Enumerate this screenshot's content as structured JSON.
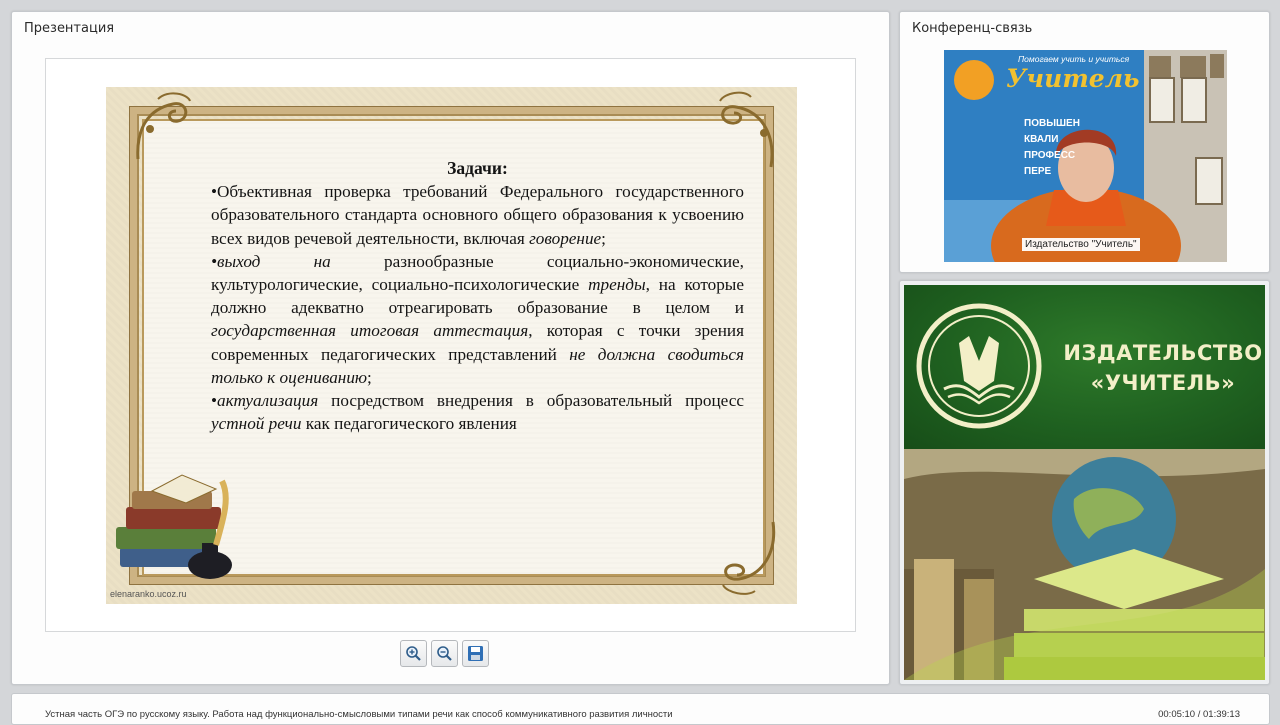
{
  "presentation": {
    "title": "Презентация",
    "slide": {
      "heading": "Задачи:",
      "credit": "elenaranko.ucoz.ru",
      "p1_a": "•Объективная проверка требований Федерального государственного образовательного стандарта основного общего образования к усвоению всех видов речевой деятельности, включая ",
      "p1_it": "говорение",
      "p1_end": ";",
      "p2_it1": "•выход на",
      "p2_b": " разнообразные социально-экономические, культурологические, социально-психологические ",
      "p2_it2": "тренды",
      "p2_c": ", на которые должно адекватно отреагировать образование в целом и ",
      "p2_it3": "государственная итоговая аттестация",
      "p2_d": ", которая с точки зрения современных педагогических представлений ",
      "p2_it4": "не должна сводиться только к оцениванию",
      "p2_end": ";",
      "p3_bullet": "•",
      "p3_it1": "актуализация",
      "p3_b": " посредством внедрения в образовательный процесс ",
      "p3_it2": "устной речи",
      "p3_c": " как педагогического явления"
    },
    "toolbar": {
      "zoom_in_icon": "zoom-in-icon",
      "zoom_out_icon": "zoom-out-icon",
      "save_icon": "save-icon"
    }
  },
  "conference": {
    "title": "Конференц-связь",
    "participant_label": "Издательство \"Учитель\"",
    "banner_small": "Помогаем учить и учиться",
    "banner_big": "Учитель",
    "banner_line1": "ПОВЫШЕН",
    "banner_line2": "КВАЛИ",
    "banner_line3": "ПРОФЕСС",
    "banner_line4": "ПЕРЕ"
  },
  "promo": {
    "line1": "ИЗДАТЕЛЬСТВО",
    "line2": "«УЧИТЕЛЬ»"
  },
  "footer": {
    "title": "Устная часть ОГЭ по русскому языку.  Работа над функционально-смысловыми типами речи как способ коммуникативного развития личности",
    "time": "00:05:10 / 01:39:13"
  },
  "colors": {
    "promo_green": "#1f6120",
    "promo_text": "#f3efc8",
    "frame_gold": "#cdb383"
  }
}
